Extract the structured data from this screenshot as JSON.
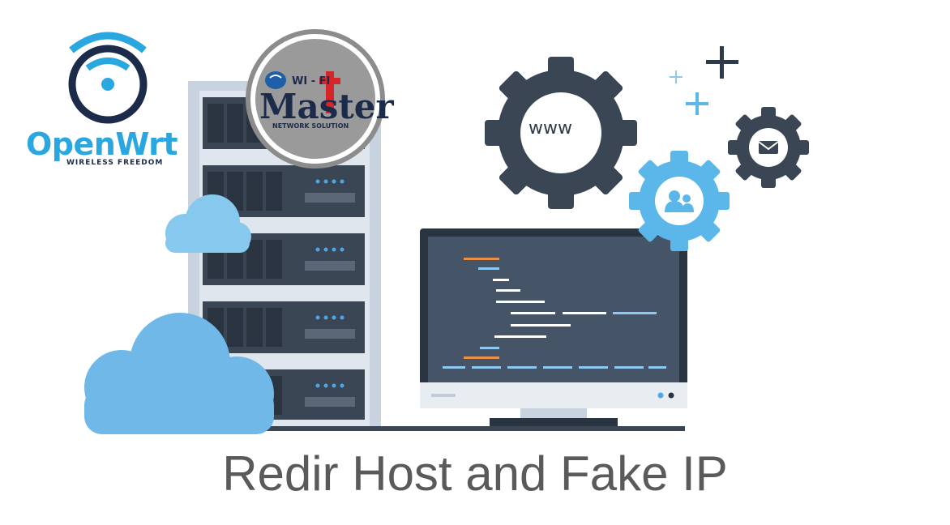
{
  "caption": "Redir Host and Fake IP",
  "openwrt_logo": {
    "name": "OpenWrt",
    "tagline": "WIRELESS FREEDOM",
    "icon": "wifi-icon"
  },
  "wifimaster_logo": {
    "top_text": "WI - FI",
    "name": "Master",
    "sub_text": "NETWORK SOLUTION"
  },
  "gear_www": {
    "label": "www"
  },
  "icons": [
    "server-rack-icon",
    "cloud-icon",
    "monitor-icon",
    "gear-icon",
    "users-icon",
    "mail-icon",
    "plus-icon"
  ],
  "colors": {
    "caption": "#5a5a5a",
    "openwrt_blue": "#2aa7e0",
    "navy": "#1d2b4a",
    "cloud": "#7fc4ee",
    "server_dark": "#3b4654",
    "accent_blue": "#4aa8e8",
    "accent_orange": "#e8904a"
  }
}
